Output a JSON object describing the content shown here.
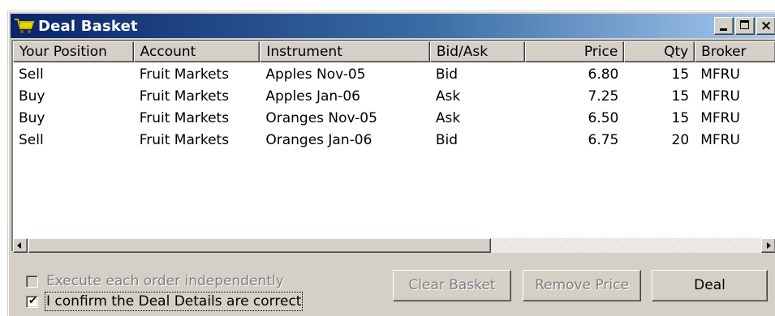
{
  "window": {
    "title": "Deal Basket",
    "controls": {
      "minimize": "minimize-icon",
      "maximize": "maximize-icon",
      "close": "close-icon"
    },
    "title_gradient": [
      "#0a246a",
      "#a6caf0"
    ],
    "face_color": "#d4d0c8"
  },
  "table": {
    "columns": [
      "Your Position",
      "Account",
      "Instrument",
      "Bid/Ask",
      "Price",
      "Qty",
      "Broker"
    ],
    "rows": [
      [
        "Sell",
        "Fruit Markets",
        "Apples Nov-05",
        "Bid",
        "6.80",
        "15",
        "MFRU"
      ],
      [
        "Buy",
        "Fruit Markets",
        "Apples Jan-06",
        "Ask",
        "7.25",
        "15",
        "MFRU"
      ],
      [
        "Buy",
        "Fruit Markets",
        "Oranges Nov-05",
        "Ask",
        "6.50",
        "15",
        "MFRU"
      ],
      [
        "Sell",
        "Fruit Markets",
        "Oranges Jan-06",
        "Bid",
        "6.75",
        "20",
        "MFRU"
      ]
    ]
  },
  "options": {
    "execute_independently": {
      "label": "Execute each order independently",
      "checked": false,
      "enabled": false
    },
    "confirm_details": {
      "label": "I confirm the Deal Details are correct",
      "checked": true,
      "enabled": true
    }
  },
  "buttons": {
    "clear_basket": "Clear Basket",
    "remove_price": "Remove Price",
    "deal": "Deal"
  }
}
